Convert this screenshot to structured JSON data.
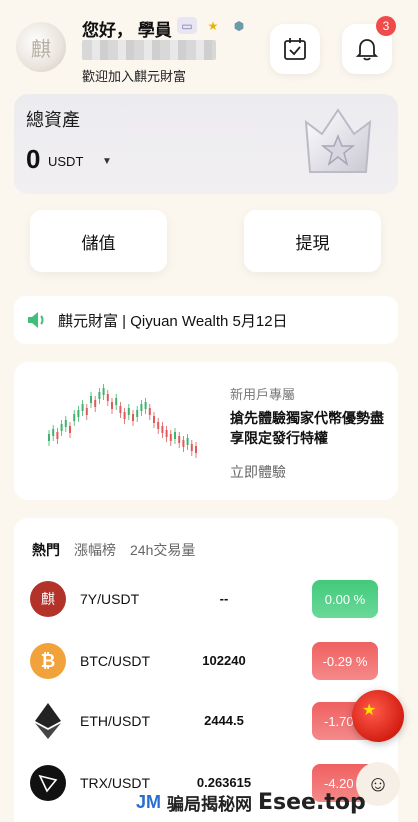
{
  "header": {
    "greeting": "您好， 學員",
    "welcome": "歡迎加入麒元財富",
    "notification_count": "3",
    "avatar_icon": "avatar-logo",
    "badges": [
      "id-card-icon",
      "star-badge-icon",
      "gem-badge-icon"
    ]
  },
  "assets": {
    "title": "總資產",
    "value": "0",
    "currency": "USDT",
    "caret": "▼"
  },
  "actions": {
    "deposit": "儲值",
    "withdraw": "提現"
  },
  "notice": {
    "text": "麒元財富 | Qiyuan Wealth 5月12日",
    "icon": "speaker-icon"
  },
  "promo": {
    "subtitle": "新用戶專屬",
    "headline": "搶先體驗獨家代幣優勢盡享限定發行特權",
    "cta": "立即體驗"
  },
  "market": {
    "tabs": [
      {
        "label": "熱門",
        "active": true
      },
      {
        "label": "漲幅榜",
        "active": false
      },
      {
        "label": "24h交易量",
        "active": false
      }
    ],
    "rows": [
      {
        "pair": "7Y/USDT",
        "price": "--",
        "change": "0.00 %",
        "direction": "up"
      },
      {
        "pair": "BTC/USDT",
        "price": "102240",
        "change": "-0.29 %",
        "direction": "down"
      },
      {
        "pair": "ETH/USDT",
        "price": "2444.5",
        "change": "-1.70",
        "direction": "down"
      },
      {
        "pair": "TRX/USDT",
        "price": "0.263615",
        "change": "-4.20",
        "direction": "down"
      }
    ]
  },
  "watermark": {
    "logo": "JM",
    "cn": "骗局揭秘网",
    "en": "Esee.top"
  },
  "colors": {
    "background": "#fbf6ee",
    "up": "#42c97a",
    "down": "#f06060",
    "badge": "#ef4b4b"
  }
}
